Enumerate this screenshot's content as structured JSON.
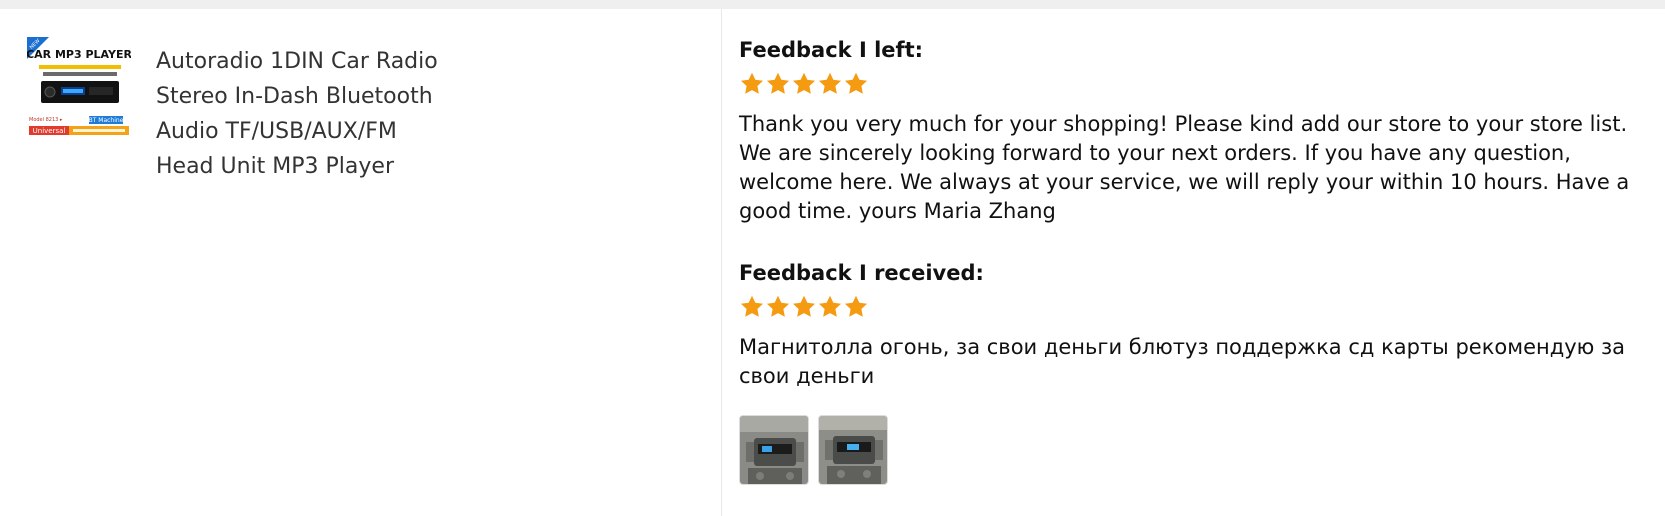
{
  "product": {
    "thumbnail": {
      "banner_text": "CAR MP3 PLAYER",
      "corner_badge": "NEW",
      "tag_left": "Universal",
      "tag_right": "BT Machine"
    },
    "title_lines": [
      "Autoradio 1DIN Car Radio",
      "Stereo In-Dash Bluetooth",
      "Audio TF/USB/AUX/FM",
      "Head Unit MP3 Player"
    ]
  },
  "feedback_left": {
    "heading": "Feedback I left:",
    "rating": 5,
    "rating_max": 5,
    "text": "Thank you very much for your shopping! Please kind add our store to your store list. We are sincerely looking forward to your next orders. If you have any question, welcome here. We always at your service, we will reply your within 10 hours. Have a good time. yours Maria Zhang"
  },
  "feedback_received": {
    "heading": "Feedback I received:",
    "rating": 5,
    "rating_max": 5,
    "text": "Магнитолла огонь, за свои деньги блютуз поддержка сд карты рекомендую за свои деньги",
    "photos": [
      {
        "alt": "car-radio-installed-photo-1"
      },
      {
        "alt": "car-radio-installed-photo-2"
      }
    ]
  },
  "colors": {
    "star": "#f59b12",
    "topbar": "#efefef",
    "divider": "#e8e8e8",
    "title_text": "#333333",
    "body_text": "#111111"
  },
  "icons": {
    "star": "star-icon"
  }
}
